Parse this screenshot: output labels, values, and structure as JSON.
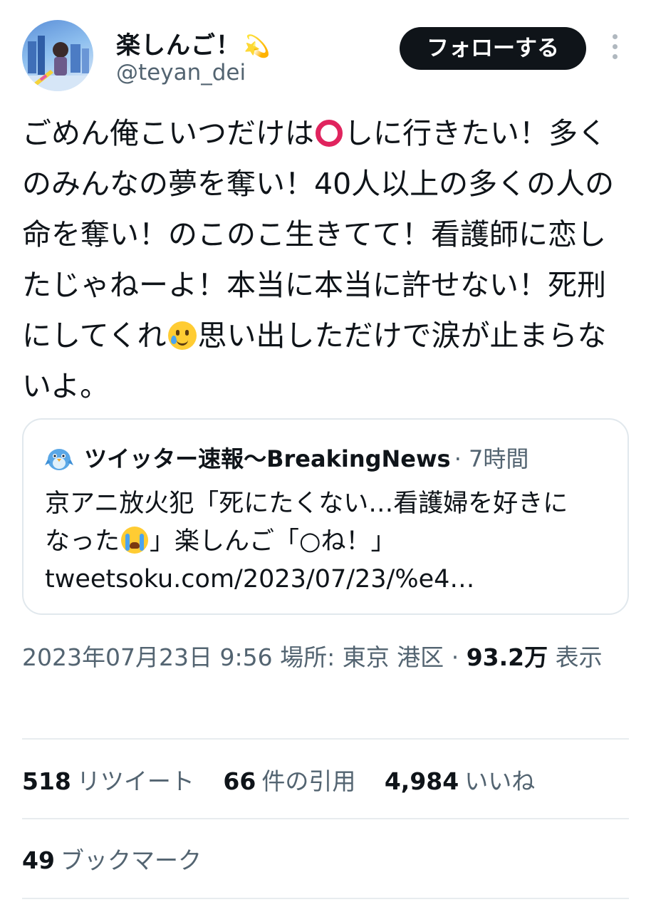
{
  "author": {
    "display_name": "楽しんご！",
    "display_name_emoji": "💫",
    "handle": "@teyan_dei"
  },
  "follow_button_label": "フォローする",
  "tweet": {
    "text_part1": "ごめん俺こいつだけは",
    "text_part2": "しに行きたい！多くのみんなの夢を奪い！40人以上の多くの人の命を奪い！のこのこ生きてて！看護師に恋したじゃねーよ！本当に本当に許せない！死刑にしてくれ",
    "text_part3": "思い出しただけで涙が止まらないよ。",
    "emoji_1": "red-hollow-circle-icon",
    "emoji_2": "smiling-face-with-tear-icon"
  },
  "quote": {
    "account_name": "ツイッター速報〜BreakingNews",
    "time": "· 7時間",
    "text_line1": "京アニ放火犯「死にたくない…看護婦を好きに",
    "text_line2_part1": "なった",
    "text_line2_part2": "」楽しんご「○ね！」",
    "url": "tweetsoku.com/2023/07/23/%e4…",
    "emoji": "loudly-crying-face-icon",
    "avatar_icon": "blue-bird-icon"
  },
  "meta": {
    "datetime": "2023年07月23日 9:56",
    "location_label": "場所:",
    "location": "東京 港区",
    "separator": "·",
    "views_count": "93.2万",
    "views_label": "表示"
  },
  "stats": {
    "retweets_count": "518",
    "retweets_label": "リツイート",
    "quotes_count": "66",
    "quotes_label": "件の引用",
    "likes_count": "4,984",
    "likes_label": "いいね",
    "bookmarks_count": "49",
    "bookmarks_label": "ブックマーク"
  },
  "colors": {
    "text": "#0f1419",
    "secondary": "#536471",
    "follow_bg": "#0f1419",
    "border": "#e1e8ed"
  }
}
